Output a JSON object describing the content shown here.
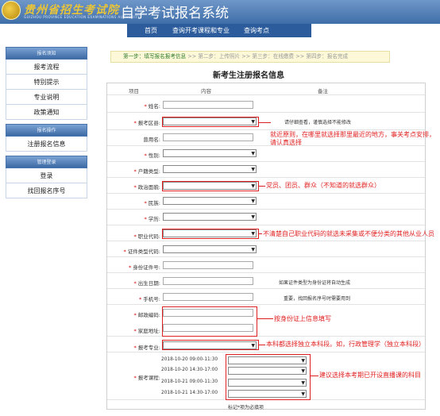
{
  "header": {
    "logo_text": "贵州省招生考试院",
    "logo_sub": "GUIZHOU PROVINCE EDUCATION EXAMINATIONS AUTHORITY",
    "system_title": "自学考试报名系统"
  },
  "nav": [
    "首页",
    "查询开考课程和专业",
    "查询考点"
  ],
  "sidebar": {
    "groups": [
      {
        "title": "报名须知",
        "items": [
          "报考流程",
          "特别提示",
          "专业说明",
          "政策通知"
        ]
      },
      {
        "title": "报名操作",
        "items": [
          "注册报名信息"
        ]
      },
      {
        "title": "管理登录",
        "items": [
          "登录",
          "找回报名序号"
        ]
      }
    ]
  },
  "steps": {
    "active": "第一步：填写报名报考信息",
    "rest": " >> 第二步：上传照片 >> 第三步：在线缴费 >> 第四步：报名完成"
  },
  "form": {
    "title": "新考生注册报名信息",
    "headers": {
      "item": "项目",
      "content": "内容",
      "remark": "备注"
    },
    "fields": {
      "name": "姓名:",
      "region": "报考区县:",
      "used_name": "曾用名:",
      "gender": "性别:",
      "household": "户籍类型:",
      "political": "政治面貌:",
      "ethnic": "民族:",
      "education": "学历:",
      "occupation": "职业代码:",
      "id_type": "证件类型代码:",
      "id_no": "身份证件号:",
      "birth": "出生日期:",
      "mobile": "手机号:",
      "postcode": "邮政编码:",
      "address": "家庭地址:",
      "major": "报考专业:",
      "courses": "报考课程:"
    },
    "notes": {
      "region": "请仔细查看，谨慎选择不能修改",
      "birth": "如果证件类型为身份证将自动生成",
      "mobile": "重要，找回报名序号时需要用到"
    },
    "course_dates": [
      "2018-10-20 09:00-11:30",
      "2018-10-20 14:30-17:00",
      "2018-10-21 09:00-11:30",
      "2018-10-21 14:30-17:00"
    ],
    "footer": "标记*项为必填项"
  },
  "tips": {
    "region": "就近原则，在哪里就选择那里最近的地方，事关考点安排，请认真选择",
    "political": "党员、团员、群众（不知道的就选群众）",
    "occupation": "不清楚自己职业代码的就选未采集或不便分类的其他从业人员",
    "address": "按身份证上信息填写",
    "major": "本科都选择独立本科段。如，行政管理学（独立本科段）",
    "courses": "建议选择本考期已开设直播课的科目"
  },
  "colors": {
    "annotation": "#e02020",
    "header": "#3f6ea8",
    "step_bg": "#fdf9d8"
  }
}
